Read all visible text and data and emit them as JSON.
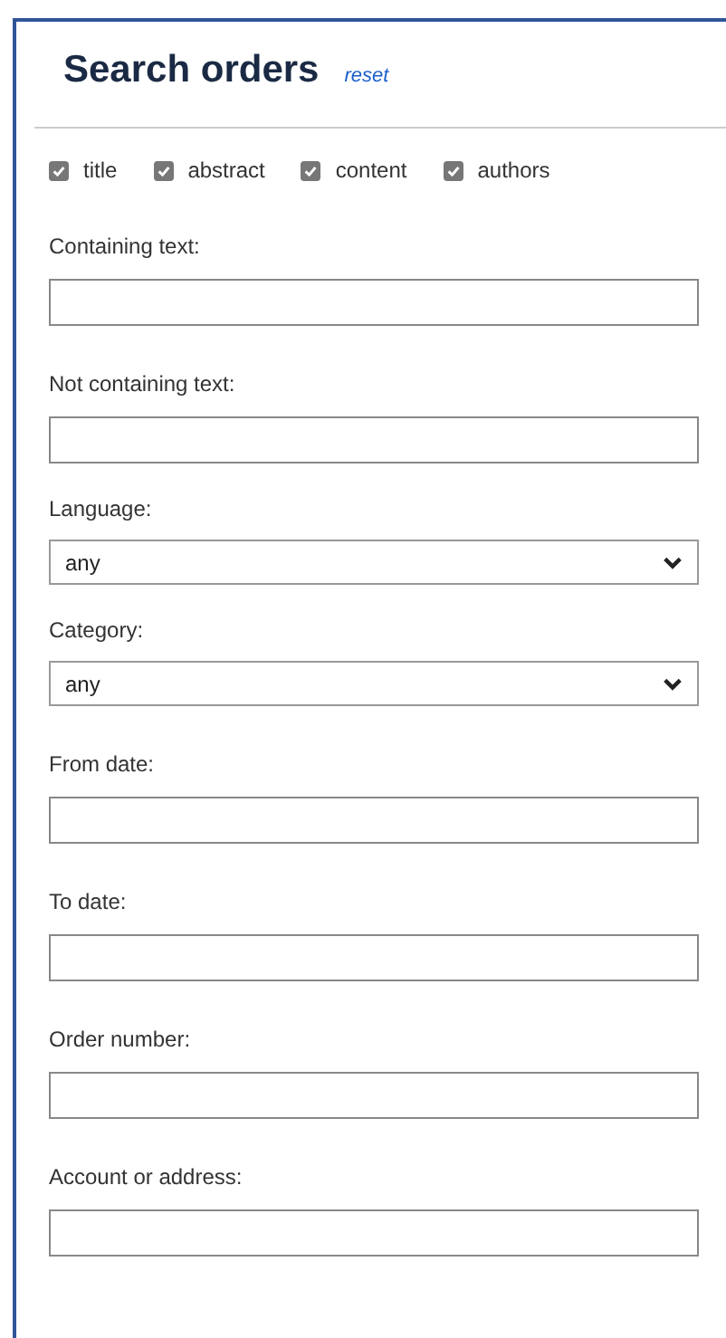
{
  "title": "Search orders",
  "reset_link": "reset",
  "scopes": [
    {
      "label": "title",
      "checked": true
    },
    {
      "label": "abstract",
      "checked": true
    },
    {
      "label": "content",
      "checked": true
    },
    {
      "label": "authors",
      "checked": true
    }
  ],
  "fields": [
    {
      "kind": "text",
      "label": "Containing text:"
    },
    {
      "kind": "text",
      "label": "Not containing text:"
    },
    {
      "kind": "select",
      "label": "Language:",
      "value": "any"
    },
    {
      "kind": "select",
      "label": "Category:",
      "value": "any"
    },
    {
      "kind": "text",
      "label": "From date:"
    },
    {
      "kind": "text",
      "label": "To date:"
    },
    {
      "kind": "text",
      "label": "Order number:"
    },
    {
      "kind": "text",
      "label": "Account or address:"
    }
  ]
}
